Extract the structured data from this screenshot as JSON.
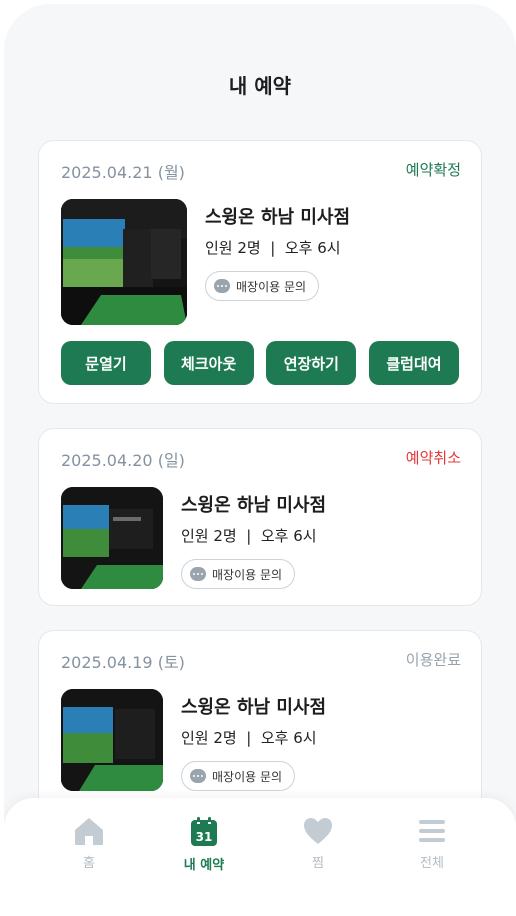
{
  "page": {
    "title": "내 예약"
  },
  "reservations": [
    {
      "date": "2025.04.21 (월)",
      "status": "예약확정",
      "store": "스윙온 하남 미사점",
      "info": "인원 2명  |  오후 6시",
      "inquiry_label": "매장이용 문의",
      "actions": [
        "문열기",
        "체크아웃",
        "연장하기",
        "클럽대여"
      ]
    },
    {
      "date": "2025.04.20 (일)",
      "status": "예약취소",
      "store": "스윙온 하남 미사점",
      "info": "인원 2명  |  오후 6시",
      "inquiry_label": "매장이용 문의"
    },
    {
      "date": "2025.04.19 (토)",
      "status": "이용완료",
      "store": "스윙온 하남 미사점",
      "info": "인원 2명  |  오후 6시",
      "inquiry_label": "매장이용 문의"
    }
  ],
  "tabbar": {
    "items": [
      {
        "label": "홈",
        "icon": "home-icon"
      },
      {
        "label": "내 예약",
        "icon": "calendar-icon",
        "icon_text": "31",
        "active": true
      },
      {
        "label": "찜",
        "icon": "heart-icon"
      },
      {
        "label": "전체",
        "icon": "menu-icon"
      }
    ]
  },
  "colors": {
    "accent": "#1d7a52",
    "cancel": "#e5383b",
    "done": "#98a3ae",
    "inactive_tab": "#b3bcc4"
  }
}
